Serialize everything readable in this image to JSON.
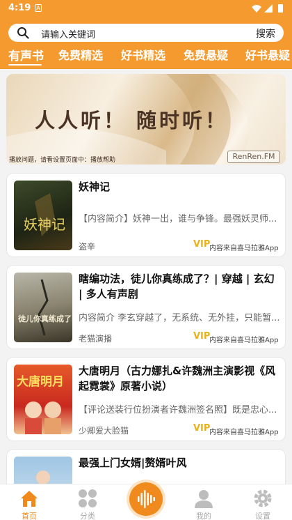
{
  "status": {
    "time": "4:19",
    "notification": "A"
  },
  "search": {
    "placeholder": "请输入关键词",
    "button": "搜索"
  },
  "tabs": [
    {
      "label": "有声书",
      "active": true
    },
    {
      "label": "免费精选"
    },
    {
      "label": "好书精选"
    },
    {
      "label": "免费悬疑"
    },
    {
      "label": "好书悬疑"
    }
  ],
  "banner": {
    "title": "人人听！ 随时听！",
    "caption": "播放问题，请看设置页面中：播放帮助",
    "logo": "RenRen.FM"
  },
  "books": [
    {
      "title": "妖神记",
      "description": "【内容简介】妖神一出，谁与争锋。最强妖灵师...",
      "author": "盗辛",
      "vip": "VIP",
      "source": "内容来自喜马拉雅App",
      "cover_text": "妖神记"
    },
    {
      "title": "瞎编功法，徒儿你真练成了？| 穿越 | 玄幻 | 多人有声剧",
      "description": "内容简介 李玄穿越了，无系统、无外挂，只能暂...",
      "author": "老猫演播",
      "vip": "VIP",
      "source": "内容来自喜马拉雅App",
      "cover_text": "徒儿你真练成了"
    },
    {
      "title": "大唐明月（古力娜扎&许魏洲主演影视《风起霓裳》原著小说）",
      "description": "【评论送装行位扮演者许魏洲签名照】既是忠心...",
      "author": "少卿爱大脸猫",
      "vip": "VIP",
      "source": "内容来自喜马拉雅App",
      "cover_text": "大唐明月"
    },
    {
      "title": "最强上门女婿|赘婿叶风"
    }
  ],
  "nav": [
    {
      "label": "首页",
      "icon": "home-icon",
      "active": true
    },
    {
      "label": "分类",
      "icon": "category-icon"
    },
    {
      "label": "我的",
      "icon": "profile-icon"
    },
    {
      "label": "设置",
      "icon": "settings-icon"
    }
  ],
  "colors": {
    "accent": "#f59a2f",
    "vip": "#e8b31a",
    "nav_active": "#f08a1c"
  }
}
